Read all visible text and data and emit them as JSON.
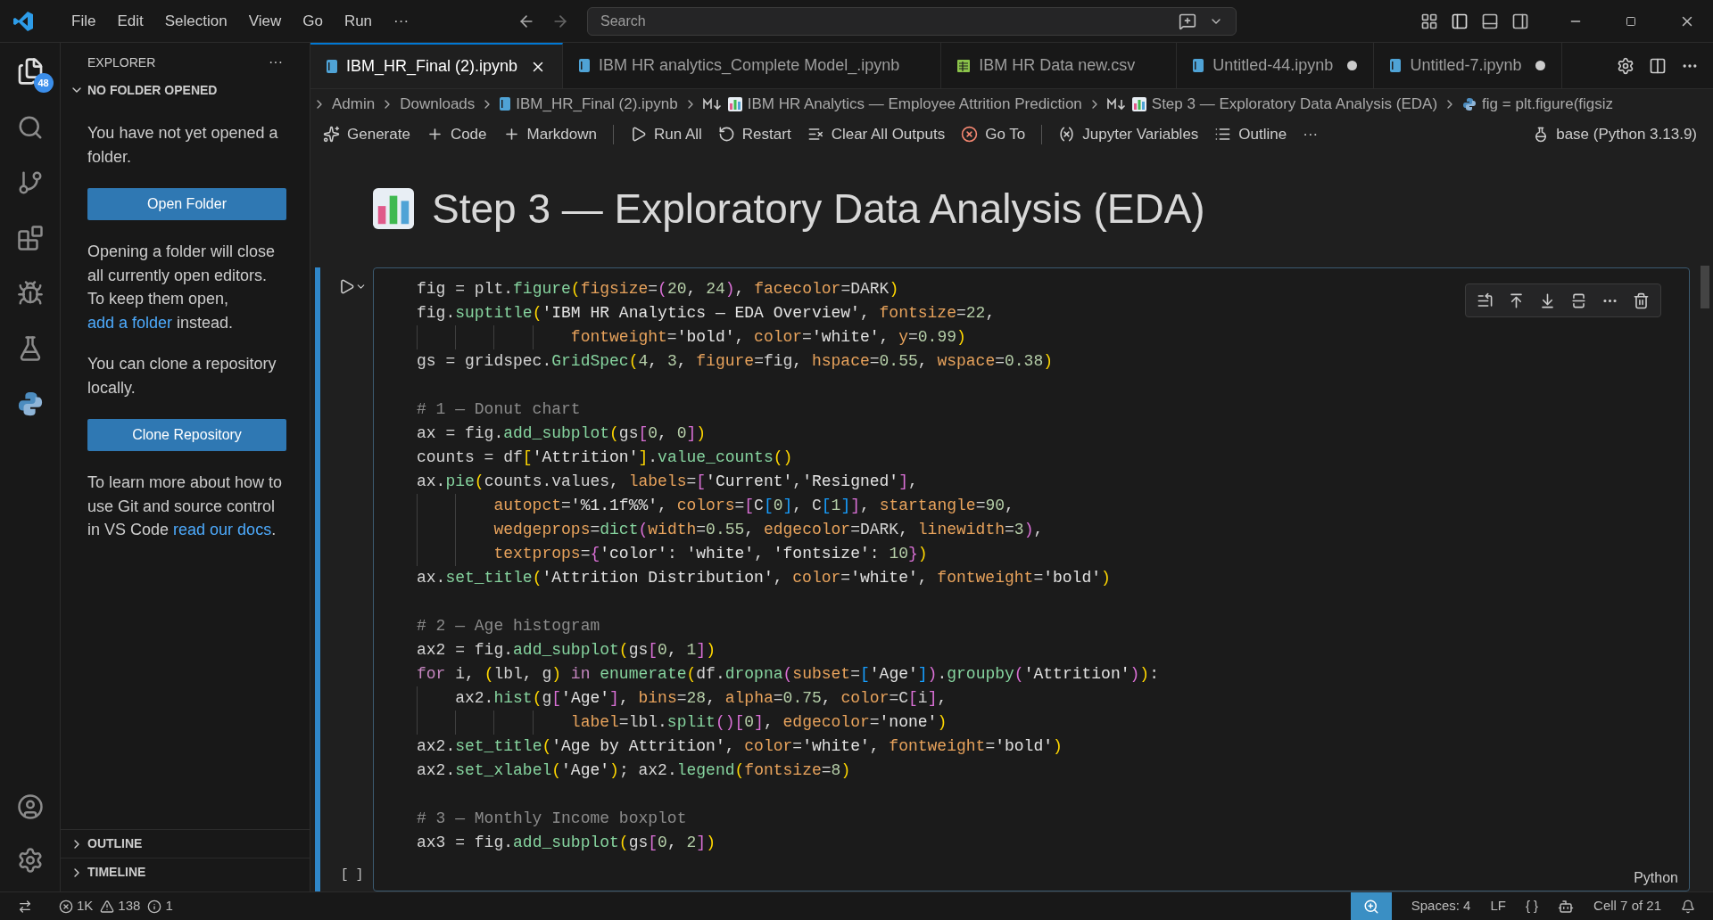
{
  "menu": [
    "File",
    "Edit",
    "Selection",
    "View",
    "Go",
    "Run",
    "···"
  ],
  "search": {
    "placeholder": "Search"
  },
  "activity_bar": {
    "explorer_badge": "48"
  },
  "sidebar": {
    "title": "EXPLORER",
    "more": "···",
    "section": "NO FOLDER OPENED",
    "intro": "You have not yet opened a folder.",
    "open_button": "Open Folder",
    "close_note": {
      "text": "Opening a folder will close all currently open editors. To keep them open, ",
      "link": "add a folder",
      "after": " instead."
    },
    "clone_note": "You can clone a repository locally.",
    "clone_button": "Clone Repository",
    "learn_note": {
      "text": "To learn more about how to use Git and source control in VS Code ",
      "link": "read our docs",
      "after": "."
    },
    "panels": [
      "OUTLINE",
      "TIMELINE"
    ]
  },
  "tabs": [
    {
      "label": "IBM_HR_Final (2).ipynb",
      "kind": "notebook",
      "selected": true,
      "dirty": false
    },
    {
      "label": "IBM HR analytics_Complete Model_.ipynb",
      "kind": "notebook",
      "selected": false,
      "dirty": false
    },
    {
      "label": "IBM HR Data new.csv",
      "kind": "csv",
      "selected": false,
      "dirty": false
    },
    {
      "label": "Untitled-44.ipynb",
      "kind": "notebook",
      "selected": false,
      "dirty": true
    },
    {
      "label": "Untitled-7.ipynb",
      "kind": "notebook",
      "selected": false,
      "dirty": true
    }
  ],
  "breadcrumb": [
    {
      "label": "Admin",
      "kind": "folder"
    },
    {
      "label": "Downloads",
      "kind": "folder"
    },
    {
      "label": "IBM_HR_Final (2).ipynb",
      "kind": "notebook"
    },
    {
      "label": "IBM HR Analytics — Employee Attrition Prediction",
      "kind": "markdown"
    },
    {
      "label": "Step 3 — Exploratory Data Analysis (EDA)",
      "kind": "markdown"
    },
    {
      "label": "fig = plt.figure(figsiz",
      "kind": "python"
    }
  ],
  "toolbar": [
    {
      "label": "Generate",
      "kind": "sparkle"
    },
    {
      "label": "Code",
      "kind": "plus"
    },
    {
      "label": "Markdown",
      "kind": "plus",
      "divider_after": true
    },
    {
      "label": "Run All",
      "kind": "run"
    },
    {
      "label": "Restart",
      "kind": "restart"
    },
    {
      "label": "Clear All Outputs",
      "kind": "clear"
    },
    {
      "label": "Go To",
      "kind": "goto",
      "divider_after": true
    },
    {
      "label": "Jupyter Variables",
      "kind": "variables"
    },
    {
      "label": "Outline",
      "kind": "outline"
    },
    {
      "label": "···",
      "kind": "more"
    }
  ],
  "kernel": "base (Python 3.13.9)",
  "heading": "Step 3 — Exploratory Data Analysis (EDA)",
  "cell": {
    "execution_count": "[ ]",
    "language": "Python",
    "blocks": [
      [
        [
          {
            "kind": "v",
            "text": "fig = plt."
          },
          {
            "kind": "f",
            "text": "figure"
          },
          {
            "kind": "b1",
            "text": "("
          },
          {
            "kind": "p",
            "text": "figsize"
          },
          {
            "kind": "v",
            "text": "="
          },
          {
            "kind": "b2",
            "text": "("
          },
          {
            "kind": "n",
            "text": "20"
          },
          {
            "kind": "v",
            "text": ", "
          },
          {
            "kind": "n",
            "text": "24"
          },
          {
            "kind": "b2",
            "text": ")"
          },
          {
            "kind": "v",
            "text": ", "
          },
          {
            "kind": "p",
            "text": "facecolor"
          },
          {
            "kind": "v",
            "text": "=DARK"
          },
          {
            "kind": "b1",
            "text": ")"
          }
        ],
        [
          {
            "kind": "v",
            "text": "fig."
          },
          {
            "kind": "f",
            "text": "suptitle"
          },
          {
            "kind": "b1",
            "text": "("
          },
          {
            "kind": "s",
            "text": "'IBM HR Analytics — EDA Overview'"
          },
          {
            "kind": "v",
            "text": ", "
          },
          {
            "kind": "p",
            "text": "fontsize"
          },
          {
            "kind": "v",
            "text": "="
          },
          {
            "kind": "n",
            "text": "22"
          },
          {
            "kind": "v",
            "text": ","
          }
        ],
        [
          {
            "kind": "p",
            "text": "                fontweight"
          },
          {
            "kind": "v",
            "text": "="
          },
          {
            "kind": "s",
            "text": "'bold'"
          },
          {
            "kind": "v",
            "text": ", "
          },
          {
            "kind": "p",
            "text": "color"
          },
          {
            "kind": "v",
            "text": "="
          },
          {
            "kind": "s",
            "text": "'white'"
          },
          {
            "kind": "v",
            "text": ", "
          },
          {
            "kind": "p",
            "text": "y"
          },
          {
            "kind": "v",
            "text": "="
          },
          {
            "kind": "n",
            "text": "0.99"
          },
          {
            "kind": "b1",
            "text": ")"
          }
        ],
        [
          {
            "kind": "v",
            "text": "gs = gridspec."
          },
          {
            "kind": "f",
            "text": "GridSpec"
          },
          {
            "kind": "b1",
            "text": "("
          },
          {
            "kind": "n",
            "text": "4"
          },
          {
            "kind": "v",
            "text": ", "
          },
          {
            "kind": "n",
            "text": "3"
          },
          {
            "kind": "v",
            "text": ", "
          },
          {
            "kind": "p",
            "text": "figure"
          },
          {
            "kind": "v",
            "text": "=fig, "
          },
          {
            "kind": "p",
            "text": "hspace"
          },
          {
            "kind": "v",
            "text": "="
          },
          {
            "kind": "n",
            "text": "0.55"
          },
          {
            "kind": "v",
            "text": ", "
          },
          {
            "kind": "p",
            "text": "wspace"
          },
          {
            "kind": "v",
            "text": "="
          },
          {
            "kind": "n",
            "text": "0.38"
          },
          {
            "kind": "b1",
            "text": ")"
          }
        ]
      ],
      [
        [
          {
            "kind": "c",
            "text": "# 1 — Donut chart"
          }
        ],
        [
          {
            "kind": "v",
            "text": "ax = fig."
          },
          {
            "kind": "f",
            "text": "add_subplot"
          },
          {
            "kind": "b1",
            "text": "("
          },
          {
            "kind": "v",
            "text": "gs"
          },
          {
            "kind": "b2",
            "text": "["
          },
          {
            "kind": "n",
            "text": "0"
          },
          {
            "kind": "v",
            "text": ", "
          },
          {
            "kind": "n",
            "text": "0"
          },
          {
            "kind": "b2",
            "text": "]"
          },
          {
            "kind": "b1",
            "text": ")"
          }
        ],
        [
          {
            "kind": "v",
            "text": "counts = df"
          },
          {
            "kind": "b1",
            "text": "["
          },
          {
            "kind": "s",
            "text": "'Attrition'"
          },
          {
            "kind": "b1",
            "text": "]"
          },
          {
            "kind": "v",
            "text": "."
          },
          {
            "kind": "f",
            "text": "value_counts"
          },
          {
            "kind": "b1",
            "text": "()"
          }
        ],
        [
          {
            "kind": "v",
            "text": "ax."
          },
          {
            "kind": "f",
            "text": "pie"
          },
          {
            "kind": "b1",
            "text": "("
          },
          {
            "kind": "v",
            "text": "counts.values, "
          },
          {
            "kind": "p",
            "text": "labels"
          },
          {
            "kind": "v",
            "text": "="
          },
          {
            "kind": "b2",
            "text": "["
          },
          {
            "kind": "s",
            "text": "'Current'"
          },
          {
            "kind": "v",
            "text": ","
          },
          {
            "kind": "s",
            "text": "'Resigned'"
          },
          {
            "kind": "b2",
            "text": "]"
          },
          {
            "kind": "v",
            "text": ","
          }
        ],
        [
          {
            "kind": "p",
            "text": "        autopct"
          },
          {
            "kind": "v",
            "text": "="
          },
          {
            "kind": "s",
            "text": "'%1.1f%%'"
          },
          {
            "kind": "v",
            "text": ", "
          },
          {
            "kind": "p",
            "text": "colors"
          },
          {
            "kind": "v",
            "text": "="
          },
          {
            "kind": "b2",
            "text": "["
          },
          {
            "kind": "v",
            "text": "C"
          },
          {
            "kind": "b3",
            "text": "["
          },
          {
            "kind": "n",
            "text": "0"
          },
          {
            "kind": "b3",
            "text": "]"
          },
          {
            "kind": "v",
            "text": ", C"
          },
          {
            "kind": "b3",
            "text": "["
          },
          {
            "kind": "n",
            "text": "1"
          },
          {
            "kind": "b3",
            "text": "]"
          },
          {
            "kind": "b2",
            "text": "]"
          },
          {
            "kind": "v",
            "text": ", "
          },
          {
            "kind": "p",
            "text": "startangle"
          },
          {
            "kind": "v",
            "text": "="
          },
          {
            "kind": "n",
            "text": "90"
          },
          {
            "kind": "v",
            "text": ","
          }
        ],
        [
          {
            "kind": "p",
            "text": "        wedgeprops"
          },
          {
            "kind": "v",
            "text": "="
          },
          {
            "kind": "f",
            "text": "dict"
          },
          {
            "kind": "b2",
            "text": "("
          },
          {
            "kind": "p",
            "text": "width"
          },
          {
            "kind": "v",
            "text": "="
          },
          {
            "kind": "n",
            "text": "0.55"
          },
          {
            "kind": "v",
            "text": ", "
          },
          {
            "kind": "p",
            "text": "edgecolor"
          },
          {
            "kind": "v",
            "text": "=DARK, "
          },
          {
            "kind": "p",
            "text": "linewidth"
          },
          {
            "kind": "v",
            "text": "="
          },
          {
            "kind": "n",
            "text": "3"
          },
          {
            "kind": "b2",
            "text": ")"
          },
          {
            "kind": "v",
            "text": ","
          }
        ],
        [
          {
            "kind": "p",
            "text": "        textprops"
          },
          {
            "kind": "v",
            "text": "="
          },
          {
            "kind": "b2",
            "text": "{"
          },
          {
            "kind": "s",
            "text": "'color'"
          },
          {
            "kind": "v",
            "text": ": "
          },
          {
            "kind": "s",
            "text": "'white'"
          },
          {
            "kind": "v",
            "text": ", "
          },
          {
            "kind": "s",
            "text": "'fontsize'"
          },
          {
            "kind": "v",
            "text": ": "
          },
          {
            "kind": "n",
            "text": "10"
          },
          {
            "kind": "b2",
            "text": "}"
          },
          {
            "kind": "b1",
            "text": ")"
          }
        ],
        [
          {
            "kind": "v",
            "text": "ax."
          },
          {
            "kind": "f",
            "text": "set_title"
          },
          {
            "kind": "b1",
            "text": "("
          },
          {
            "kind": "s",
            "text": "'Attrition Distribution'"
          },
          {
            "kind": "v",
            "text": ", "
          },
          {
            "kind": "p",
            "text": "color"
          },
          {
            "kind": "v",
            "text": "="
          },
          {
            "kind": "s",
            "text": "'white'"
          },
          {
            "kind": "v",
            "text": ", "
          },
          {
            "kind": "p",
            "text": "fontweight"
          },
          {
            "kind": "v",
            "text": "="
          },
          {
            "kind": "s",
            "text": "'bold'"
          },
          {
            "kind": "b1",
            "text": ")"
          }
        ]
      ],
      [
        [
          {
            "kind": "c",
            "text": "# 2 — Age histogram"
          }
        ],
        [
          {
            "kind": "v",
            "text": "ax2 = fig."
          },
          {
            "kind": "f",
            "text": "add_subplot"
          },
          {
            "kind": "b1",
            "text": "("
          },
          {
            "kind": "v",
            "text": "gs"
          },
          {
            "kind": "b2",
            "text": "["
          },
          {
            "kind": "n",
            "text": "0"
          },
          {
            "kind": "v",
            "text": ", "
          },
          {
            "kind": "n",
            "text": "1"
          },
          {
            "kind": "b2",
            "text": "]"
          },
          {
            "kind": "b1",
            "text": ")"
          }
        ],
        [
          {
            "kind": "k",
            "text": "for"
          },
          {
            "kind": "v",
            "text": " i, "
          },
          {
            "kind": "b1",
            "text": "("
          },
          {
            "kind": "v",
            "text": "lbl, g"
          },
          {
            "kind": "b1",
            "text": ")"
          },
          {
            "kind": "k",
            "text": " in"
          },
          {
            "kind": "f",
            "text": " enumerate"
          },
          {
            "kind": "b1",
            "text": "("
          },
          {
            "kind": "v",
            "text": "df."
          },
          {
            "kind": "f",
            "text": "dropna"
          },
          {
            "kind": "b2",
            "text": "("
          },
          {
            "kind": "p",
            "text": "subset"
          },
          {
            "kind": "v",
            "text": "="
          },
          {
            "kind": "b3",
            "text": "["
          },
          {
            "kind": "s",
            "text": "'Age'"
          },
          {
            "kind": "b3",
            "text": "]"
          },
          {
            "kind": "b2",
            "text": ")"
          },
          {
            "kind": "v",
            "text": "."
          },
          {
            "kind": "f",
            "text": "groupby"
          },
          {
            "kind": "b2",
            "text": "("
          },
          {
            "kind": "s",
            "text": "'Attrition'"
          },
          {
            "kind": "b2",
            "text": ")"
          },
          {
            "kind": "b1",
            "text": ")"
          },
          {
            "kind": "v",
            "text": ":"
          }
        ],
        [
          {
            "kind": "v",
            "text": "    ax2."
          },
          {
            "kind": "f",
            "text": "hist"
          },
          {
            "kind": "b1",
            "text": "("
          },
          {
            "kind": "v",
            "text": "g"
          },
          {
            "kind": "b2",
            "text": "["
          },
          {
            "kind": "s",
            "text": "'Age'"
          },
          {
            "kind": "b2",
            "text": "]"
          },
          {
            "kind": "v",
            "text": ", "
          },
          {
            "kind": "p",
            "text": "bins"
          },
          {
            "kind": "v",
            "text": "="
          },
          {
            "kind": "n",
            "text": "28"
          },
          {
            "kind": "v",
            "text": ", "
          },
          {
            "kind": "p",
            "text": "alpha"
          },
          {
            "kind": "v",
            "text": "="
          },
          {
            "kind": "n",
            "text": "0.75"
          },
          {
            "kind": "v",
            "text": ", "
          },
          {
            "kind": "p",
            "text": "color"
          },
          {
            "kind": "v",
            "text": "=C"
          },
          {
            "kind": "b2",
            "text": "["
          },
          {
            "kind": "v",
            "text": "i"
          },
          {
            "kind": "b2",
            "text": "]"
          },
          {
            "kind": "v",
            "text": ","
          }
        ],
        [
          {
            "kind": "p",
            "text": "                label"
          },
          {
            "kind": "v",
            "text": "=lbl."
          },
          {
            "kind": "f",
            "text": "split"
          },
          {
            "kind": "b2",
            "text": "()"
          },
          {
            "kind": "b2",
            "text": "["
          },
          {
            "kind": "n",
            "text": "0"
          },
          {
            "kind": "b2",
            "text": "]"
          },
          {
            "kind": "v",
            "text": ", "
          },
          {
            "kind": "p",
            "text": "edgecolor"
          },
          {
            "kind": "v",
            "text": "="
          },
          {
            "kind": "s",
            "text": "'none'"
          },
          {
            "kind": "b1",
            "text": ")"
          }
        ],
        [
          {
            "kind": "v",
            "text": "ax2."
          },
          {
            "kind": "f",
            "text": "set_title"
          },
          {
            "kind": "b1",
            "text": "("
          },
          {
            "kind": "s",
            "text": "'Age by Attrition'"
          },
          {
            "kind": "v",
            "text": ", "
          },
          {
            "kind": "p",
            "text": "color"
          },
          {
            "kind": "v",
            "text": "="
          },
          {
            "kind": "s",
            "text": "'white'"
          },
          {
            "kind": "v",
            "text": ", "
          },
          {
            "kind": "p",
            "text": "fontweight"
          },
          {
            "kind": "v",
            "text": "="
          },
          {
            "kind": "s",
            "text": "'bold'"
          },
          {
            "kind": "b1",
            "text": ")"
          }
        ],
        [
          {
            "kind": "v",
            "text": "ax2."
          },
          {
            "kind": "f",
            "text": "set_xlabel"
          },
          {
            "kind": "b1",
            "text": "("
          },
          {
            "kind": "s",
            "text": "'Age'"
          },
          {
            "kind": "b1",
            "text": ")"
          },
          {
            "kind": "v",
            "text": "; ax2."
          },
          {
            "kind": "f",
            "text": "legend"
          },
          {
            "kind": "b1",
            "text": "("
          },
          {
            "kind": "p",
            "text": "fontsize"
          },
          {
            "kind": "v",
            "text": "="
          },
          {
            "kind": "n",
            "text": "8"
          },
          {
            "kind": "b1",
            "text": ")"
          }
        ]
      ],
      [
        [
          {
            "kind": "c",
            "text": "# 3 — Monthly Income boxplot"
          }
        ],
        [
          {
            "kind": "v",
            "text": "ax3 = fig."
          },
          {
            "kind": "f",
            "text": "add_subplot"
          },
          {
            "kind": "b1",
            "text": "("
          },
          {
            "kind": "v",
            "text": "gs"
          },
          {
            "kind": "b2",
            "text": "["
          },
          {
            "kind": "n",
            "text": "0"
          },
          {
            "kind": "v",
            "text": ", "
          },
          {
            "kind": "n",
            "text": "2"
          },
          {
            "kind": "b2",
            "text": "]"
          },
          {
            "kind": "b1",
            "text": ")"
          }
        ]
      ]
    ]
  },
  "status_bar": {
    "errors": "1K",
    "warnings": "138",
    "infos": "1",
    "spaces": "Spaces: 4",
    "eol": "LF",
    "braces": "{ }",
    "cell": "Cell 7 of 21"
  }
}
